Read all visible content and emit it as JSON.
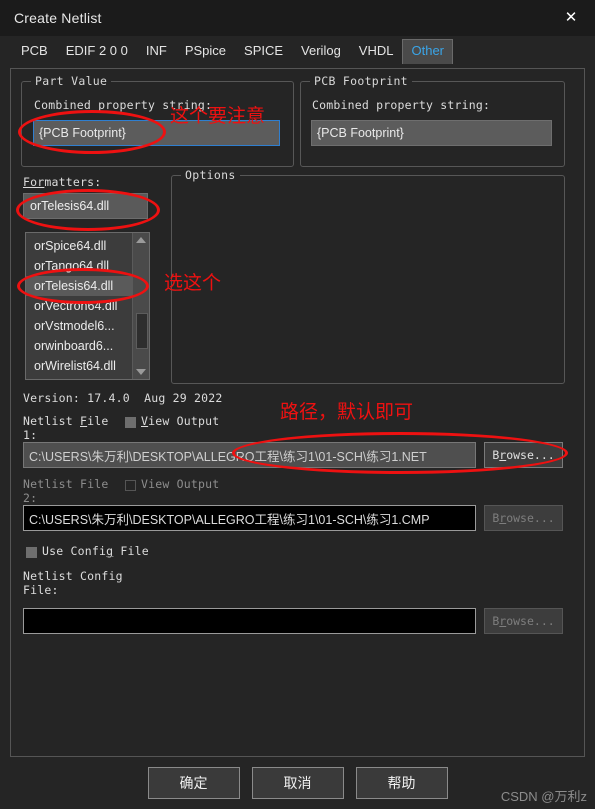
{
  "window": {
    "title": "Create Netlist",
    "close_icon": "close-icon"
  },
  "tabs": [
    {
      "label": "PCB",
      "selected": false
    },
    {
      "label": "EDIF 2 0 0",
      "selected": false
    },
    {
      "label": "INF",
      "selected": false
    },
    {
      "label": "PSpice",
      "selected": false
    },
    {
      "label": "SPICE",
      "selected": false
    },
    {
      "label": "Verilog",
      "selected": false
    },
    {
      "label": "VHDL",
      "selected": false
    },
    {
      "label": "Other",
      "selected": true
    }
  ],
  "part_value": {
    "group_title": "Part Value",
    "label": "Combined property string:",
    "value": "{PCB Footprint}"
  },
  "pcb_footprint": {
    "group_title": "PCB Footprint",
    "label": "Combined property string:",
    "value": "{PCB Footprint}"
  },
  "formatters": {
    "label": "Formatters:",
    "selected": "orTelesis64.dll",
    "items": [
      "orSpice64.dll",
      "orTango64.dll",
      "orTelesis64.dll",
      "orVectron64.dll",
      "orVstmodel6...",
      "orwinboard6...",
      "orWirelist64.dll"
    ],
    "selected_index": 2
  },
  "options": {
    "group_title": "Options"
  },
  "version": {
    "text": "Version: 17.4.0  Aug 29 2022"
  },
  "netlist1": {
    "label": "Netlist File 1:",
    "label_line1": "Netlist File",
    "label_line2": "1:",
    "view_output": "View Output",
    "view_output_checked": false,
    "path": "C:\\USERS\\朱万利\\DESKTOP\\ALLEGRO工程\\练习1\\01-SCH\\练习1.NET",
    "browse": "Browse..."
  },
  "netlist2": {
    "label_line1": "Netlist File",
    "label_line2": "2:",
    "view_output": "View Output",
    "view_output_checked": false,
    "path": "C:\\USERS\\朱万利\\DESKTOP\\ALLEGRO工程\\练习1\\01-SCH\\练习1.CMP",
    "browse": "Browse..."
  },
  "config": {
    "use_config_file": "Use Config File",
    "use_config_checked": false,
    "label_line1": "Netlist Config",
    "label_line2": "File:",
    "path": "",
    "browse": "Browse..."
  },
  "buttons": {
    "ok": "确定",
    "cancel": "取消",
    "help": "帮助"
  },
  "watermark": {
    "text": "CSDN @万利z"
  },
  "annotations": [
    {
      "text": "这个要注意",
      "id": "anno-part-value"
    },
    {
      "text": "选这个",
      "id": "anno-select-this"
    },
    {
      "text": "路径，默认即可",
      "id": "anno-path-default"
    }
  ],
  "colors": {
    "background": "#252525",
    "titlebar": "#1b1b1b",
    "accent_tab": "#3aa5e8",
    "annotation_red": "#ee1111",
    "field_bg": "#5c5c5c"
  }
}
